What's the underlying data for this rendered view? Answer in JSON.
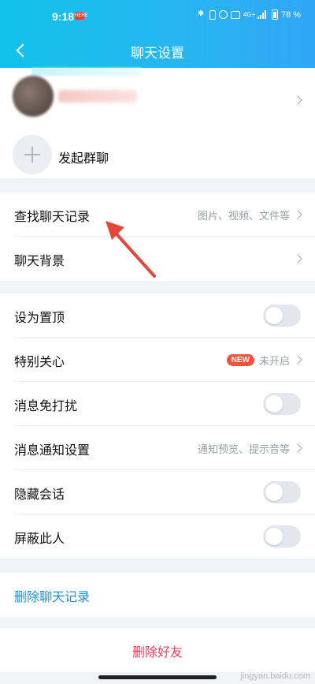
{
  "status_bar": {
    "time": "9:18",
    "network": "4G+",
    "battery": "78 %",
    "app_badge": "HERE"
  },
  "nav": {
    "title": "聊天设置"
  },
  "profile": {
    "create_group_label": "发起群聊"
  },
  "rows": {
    "search_history": {
      "label": "查找聊天记录",
      "hint": "图片、视频、文件等"
    },
    "chat_background": {
      "label": "聊天背景"
    },
    "pin_top": {
      "label": "设为置顶",
      "toggle_on": false
    },
    "special_care": {
      "label": "特别关心",
      "badge": "NEW",
      "hint": "未开启"
    },
    "do_not_disturb": {
      "label": "消息免打扰",
      "toggle_on": false
    },
    "notification_settings": {
      "label": "消息通知设置",
      "hint": "通知预览、提示音等"
    },
    "hide_chat": {
      "label": "隐藏会话",
      "toggle_on": false
    },
    "block_user": {
      "label": "屏蔽此人",
      "toggle_on": false
    },
    "delete_history": {
      "label": "删除聊天记录"
    },
    "delete_friend": {
      "label": "删除好友"
    }
  },
  "colors": {
    "header": "#27b6f2",
    "link": "#1e8fd4",
    "danger": "#ef3d5b",
    "badge": "#f2543a",
    "annotation_arrow": "#e5453b"
  },
  "watermark": "jingyan.baidu.com"
}
